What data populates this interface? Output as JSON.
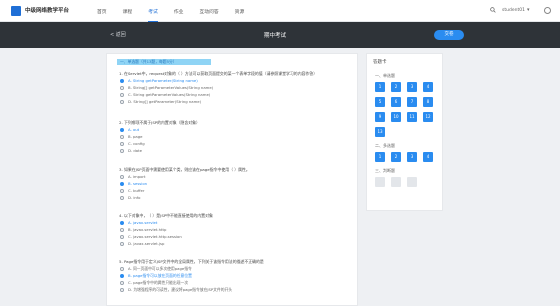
{
  "topbar": {
    "site_name": "中级网络教学平台",
    "nav": [
      "首页",
      "课程",
      "考试",
      "作业",
      "互动问答",
      "资源"
    ],
    "active_nav": 2,
    "search_icon": "search-icon",
    "user_name": "student01",
    "user_caret": "▾",
    "settings_icon": "power-icon"
  },
  "header": {
    "back_label": "< 返回",
    "exam_title": "期中考试",
    "submit_label": "交卷"
  },
  "section_tag": "一、单选题（共13题，每题5分）",
  "questions": [
    {
      "text": "1. 在Servlet中，request对象的（ ）方法可以获取页面提交的某一个表单字段的值（请参照课堂学习的内容作答）",
      "options": [
        "A. String getParameter(String name)",
        "B. String[] getParameterValues(String name)",
        "C. String getParameterValues(String name)",
        "D. String[] getParameter(String name)"
      ],
      "selected": 0
    },
    {
      "text": "2. 下列哪项不属于JSP的内置对象（隐含对象）",
      "options": [
        "A. out",
        "B. page",
        "C. config",
        "D. date"
      ],
      "selected": 0
    },
    {
      "text": "3. 如果在JSP页面中需要使用某个类，则应该在page指令中使用（ ）属性。",
      "options": [
        "A. import",
        "B. session",
        "C. buffer",
        "D. info"
      ],
      "selected": 1
    },
    {
      "text": "4. 以下对象中，（ ）是JSP中不能直接使用的内置对象",
      "options": [
        "A. javax.servlet",
        "B. javax.servlet.http",
        "C. javax.servlet.http.session",
        "D. javax.servlet.jsp"
      ],
      "selected": 0
    },
    {
      "text": "5. Page指令用于定义JSP文件中的全局属性，下列关于该指令用法的描述不正确的是",
      "options": [
        "A. 同一页面中可以多次使用page指令",
        "B. page指令可以放在页面的任意位置",
        "C. page指令中的属性只能出现一次",
        "D. 为增强程序的可读性，建议将page指令放在JSP文件的开头"
      ],
      "selected": 1
    }
  ],
  "sheet": {
    "title": "答题卡",
    "sections": [
      {
        "label": "一、单选题",
        "cells": [
          "1",
          "2",
          "3",
          "4",
          "5",
          "6",
          "7",
          "8",
          "9",
          "10",
          "11",
          "12",
          "13"
        ],
        "answered": 13
      },
      {
        "label": "二、多选题",
        "cells": [
          "1",
          "2",
          "3",
          "4"
        ],
        "answered": 4
      },
      {
        "label": "三、判断题",
        "cells": [
          "1",
          "2",
          "3"
        ],
        "answered": 0
      }
    ]
  },
  "colors": {
    "accent": "#2a8cf0",
    "header_bg": "#2e3338",
    "tag_bg": "#8fd4f5",
    "page_bg": "#eef0f3"
  }
}
